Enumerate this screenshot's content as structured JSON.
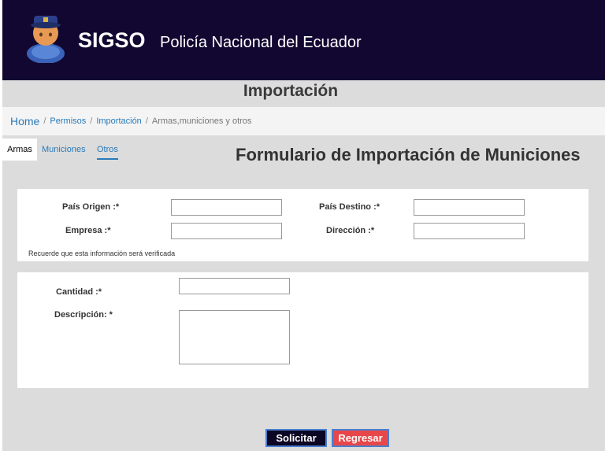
{
  "header": {
    "app_name": "SIGSO",
    "org_name": "Policía Nacional del Ecuador",
    "logo_icon": "police-officer-icon"
  },
  "page": {
    "title": "Importación"
  },
  "breadcrumb": {
    "home": "Home",
    "items": [
      "Permisos",
      "Importación"
    ],
    "current": "Armas,municiones y otros",
    "separator": "/"
  },
  "tabs": [
    {
      "label": "Armas"
    },
    {
      "label": "Municiones"
    },
    {
      "label": "Otros"
    }
  ],
  "form": {
    "title": "Formulario de Importación de Municiones",
    "pais_origen_label": "País Origen :*",
    "pais_destino_label": "País Destino :*",
    "empresa_label": "Empresa :*",
    "direccion_label": "Dirección :*",
    "note": "Recuerde que esta información será verificada",
    "cantidad_label": "Cantidad :*",
    "descripcion_label": "Descripción: *",
    "values": {
      "pais_origen": "",
      "pais_destino": "",
      "empresa": "",
      "direccion": "",
      "cantidad": "",
      "descripcion": ""
    }
  },
  "buttons": {
    "solicitar": "Solicitar",
    "regresar": "Regresar"
  },
  "colors": {
    "header_bg": "#120731",
    "link": "#2a7ab8",
    "content_bg": "#dcdcdc",
    "solicitar_bg": "#0b0623",
    "regresar_bg": "#e8474a"
  }
}
